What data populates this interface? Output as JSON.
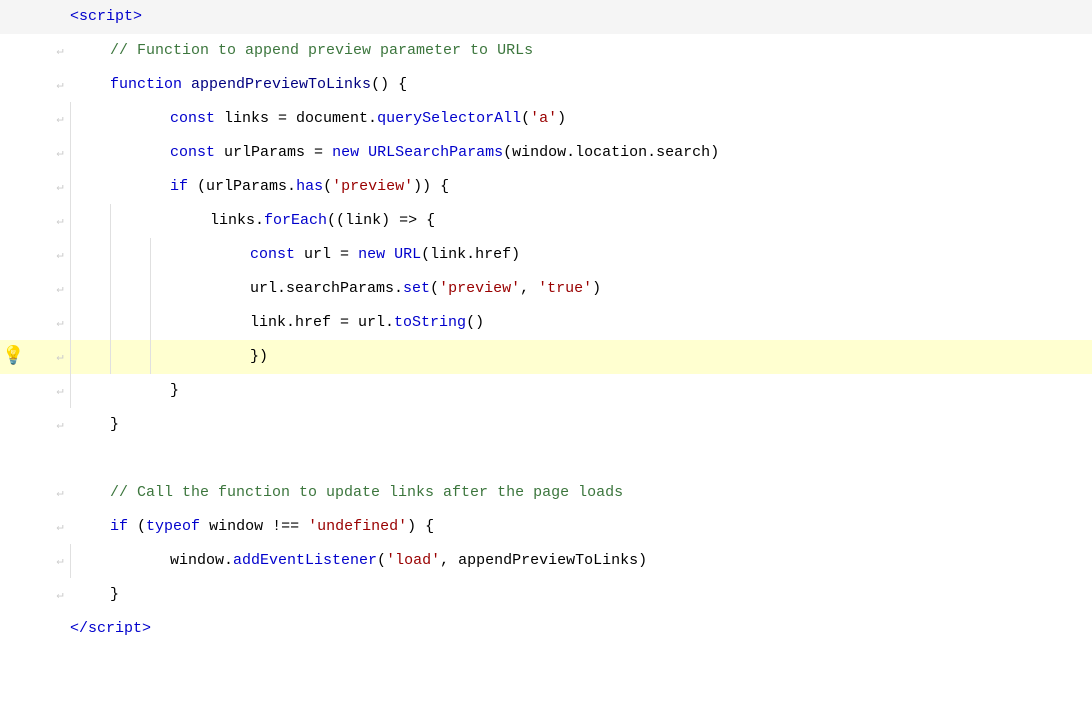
{
  "code": {
    "lines": [
      {
        "id": 1,
        "indent": 0,
        "arrows": 0,
        "content": "<c-tag>&lt;script&gt;</c-tag>",
        "has_lightbulb": false,
        "highlight": false
      },
      {
        "id": 2,
        "indent": 0,
        "arrows": 1,
        "content": "<c-comment>// Function to append preview parameter to URLs</c-comment>",
        "has_lightbulb": false,
        "highlight": false
      },
      {
        "id": 3,
        "indent": 0,
        "arrows": 1,
        "content": "<c-keyword>function</c-keyword> <c-funcname>appendPreviewToLinks</c-funcname><c-paren>()</c-paren> <c-brace>{</c-brace>",
        "has_lightbulb": false,
        "highlight": false
      },
      {
        "id": 4,
        "indent": 1,
        "arrows": 2,
        "content": "<c-keyword>const</c-keyword> links <c-operator>=</c-operator> document<c-dot>.</c-dot><c-method>querySelectorAll</c-method><c-paren>(<c-string>'a'</c-string>)</c-paren>",
        "has_lightbulb": false,
        "highlight": false
      },
      {
        "id": 5,
        "indent": 1,
        "arrows": 2,
        "content": "<c-keyword>const</c-keyword> urlParams <c-operator>=</c-operator> <c-keyword>new</c-keyword> <c-builtin>URLSearchParams</c-builtin><c-paren>(</c-paren>window<c-dot>.</c-dot>location<c-dot>.</c-dot>search<c-paren>)</c-paren>",
        "has_lightbulb": false,
        "highlight": false
      },
      {
        "id": 6,
        "indent": 1,
        "arrows": 2,
        "content": "<c-keyword>if</c-keyword> <c-paren>(</c-paren>urlParams<c-dot>.</c-dot><c-method>has</c-method><c-paren>(<c-string>'preview'</c-string>))</c-paren> <c-brace>{</c-brace>",
        "has_lightbulb": false,
        "highlight": false
      },
      {
        "id": 7,
        "indent": 2,
        "arrows": 3,
        "content": "links<c-dot>.</c-dot><c-method>forEach</c-method><c-paren>(</c-paren><c-paren>(</c-paren>link<c-paren>)</c-paren> <c-operator>=&gt;</c-operator> <c-brace>{</c-brace>",
        "has_lightbulb": false,
        "highlight": false
      },
      {
        "id": 8,
        "indent": 3,
        "arrows": 4,
        "content": "<c-keyword>const</c-keyword> url <c-operator>=</c-operator> <c-keyword>new</c-keyword> <c-builtin>URL</c-builtin><c-paren>(</c-paren>link<c-dot>.</c-dot>href<c-paren>)</c-paren>",
        "has_lightbulb": false,
        "highlight": false
      },
      {
        "id": 9,
        "indent": 3,
        "arrows": 4,
        "content": "url<c-dot>.</c-dot>searchParams<c-dot>.</c-dot><c-method>set</c-method><c-paren>(<c-string>'preview'</c-string><c-operator>,</c-operator> <c-string>'true'</c-string>)</c-paren>",
        "has_lightbulb": false,
        "highlight": false
      },
      {
        "id": 10,
        "indent": 3,
        "arrows": 4,
        "content": "link<c-dot>.</c-dot>href <c-operator>=</c-operator> url<c-dot>.</c-dot><c-method>toString</c-method><c-paren>()</c-paren>",
        "has_lightbulb": false,
        "highlight": false
      },
      {
        "id": 11,
        "indent": 2,
        "arrows": 4,
        "content": "<c-brace>})</c-brace>",
        "has_lightbulb": true,
        "highlight": true
      },
      {
        "id": 12,
        "indent": 1,
        "arrows": 2,
        "content": "<c-brace>}</c-brace>",
        "has_lightbulb": false,
        "highlight": false
      },
      {
        "id": 13,
        "indent": 0,
        "arrows": 1,
        "content": "<c-brace>}</c-brace>",
        "has_lightbulb": false,
        "highlight": false
      },
      {
        "id": 14,
        "indent": 0,
        "arrows": 0,
        "content": "",
        "has_lightbulb": false,
        "highlight": false
      },
      {
        "id": 15,
        "indent": 0,
        "arrows": 1,
        "content": "<c-comment>// Call the function to update links after the page loads</c-comment>",
        "has_lightbulb": false,
        "highlight": false
      },
      {
        "id": 16,
        "indent": 0,
        "arrows": 1,
        "content": "<c-keyword>if</c-keyword> <c-paren>(</c-paren><c-keyword>typeof</c-keyword> window <c-operator>!==</c-operator> <c-string>'undefined'</c-string><c-paren>)</c-paren> <c-brace>{</c-brace>",
        "has_lightbulb": false,
        "highlight": false
      },
      {
        "id": 17,
        "indent": 1,
        "arrows": 2,
        "content": "window<c-dot>.</c-dot><c-method>addEventListener</c-method><c-paren>(<c-string>'load'</c-string><c-operator>,</c-operator> appendPreviewToLinks<c-paren>)</c-paren>",
        "has_lightbulb": false,
        "highlight": false
      },
      {
        "id": 18,
        "indent": 0,
        "arrows": 1,
        "content": "<c-brace>}</c-brace>",
        "has_lightbulb": false,
        "highlight": false
      },
      {
        "id": 19,
        "indent": 0,
        "arrows": 0,
        "content": "<c-tag>&lt;/script&gt;</c-tag>",
        "has_lightbulb": false,
        "highlight": false
      }
    ]
  }
}
